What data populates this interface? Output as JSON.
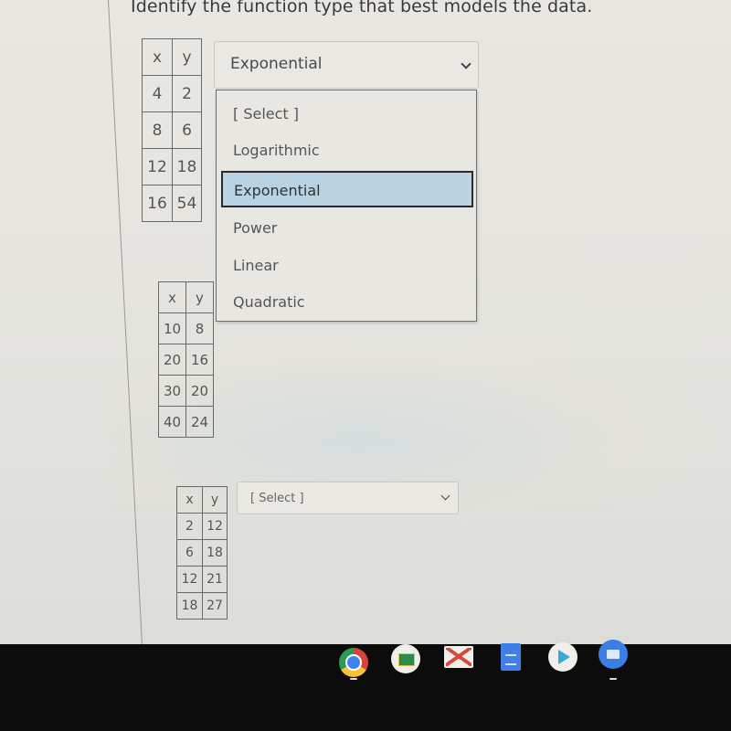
{
  "question": "Identify the function type that best models the data.",
  "problems": [
    {
      "table": {
        "headers": [
          "x",
          "y"
        ],
        "rows": [
          [
            "4",
            "2"
          ],
          [
            "8",
            "6"
          ],
          [
            "12",
            "18"
          ],
          [
            "16",
            "54"
          ]
        ]
      },
      "select": {
        "value": "Exponential",
        "open": true
      }
    },
    {
      "table": {
        "headers": [
          "x",
          "y"
        ],
        "rows": [
          [
            "10",
            "8"
          ],
          [
            "20",
            "16"
          ],
          [
            "30",
            "20"
          ],
          [
            "40",
            "24"
          ]
        ]
      },
      "select": {
        "value": "",
        "open": false
      }
    },
    {
      "table": {
        "headers": [
          "x",
          "y"
        ],
        "rows": [
          [
            "2",
            "12"
          ],
          [
            "6",
            "18"
          ],
          [
            "12",
            "21"
          ],
          [
            "18",
            "27"
          ]
        ]
      },
      "select": {
        "value": "[ Select ]",
        "open": false
      }
    }
  ],
  "dropdown_options": [
    "[ Select ]",
    "Logarithmic",
    "Exponential",
    "Power",
    "Linear",
    "Quadratic"
  ],
  "dropdown_highlighted": "Exponential",
  "shelf": {
    "apps": [
      "chrome-icon",
      "google-classroom-icon",
      "gmail-icon",
      "google-docs-icon",
      "play-store-icon",
      "files-icon"
    ]
  },
  "colors": {
    "highlight": "#b9d3e2",
    "background": "#e6e4de",
    "taskbar": "#0c0c0d"
  }
}
